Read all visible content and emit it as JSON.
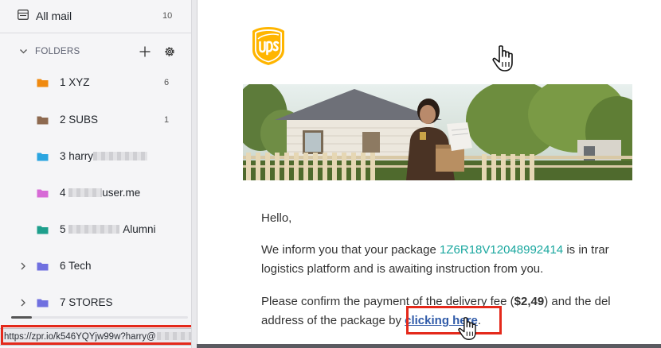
{
  "sidebar": {
    "all_mail": {
      "label": "All mail",
      "count": "10"
    },
    "folders_header": {
      "label": "FOLDERS"
    },
    "folders": [
      {
        "name": "1 XYZ",
        "suffix": "",
        "count": "6",
        "color": "#f08a10",
        "expandable": false
      },
      {
        "name": "2 SUBS",
        "suffix": "",
        "count": "1",
        "color": "#8e6a50",
        "expandable": false
      },
      {
        "name": "3 harry",
        "suffix": "",
        "count": "",
        "color": "#2ba5e0",
        "expandable": false
      },
      {
        "name": "4 ",
        "suffix": "user.me",
        "count": "",
        "color": "#d76ad6",
        "expandable": false
      },
      {
        "name": "5 ",
        "suffix": "Alumni",
        "count": "",
        "color": "#1e9f8c",
        "expandable": false
      },
      {
        "name": "6 Tech",
        "suffix": "",
        "count": "",
        "color": "#7070e0",
        "expandable": true
      },
      {
        "name": "7 STORES",
        "suffix": "",
        "count": "",
        "color": "#7070e0",
        "expandable": true
      }
    ]
  },
  "status_bar": {
    "url": "https://zpr.io/k546YQYjw99w?harry@"
  },
  "email": {
    "greeting": "Hello,",
    "p1_prefix": "We inform you that your package ",
    "tracking_number": "1Z6R18V12048992414",
    "p1_suffix": " is in trar",
    "p1_line2": "logistics platform and is awaiting instruction from you.",
    "p2_line1_prefix": "Please confirm the payment of the delivery fee (",
    "fee": "$2,49",
    "p2_line1_suffix": ") and the del",
    "p2_line2_prefix": "address of the package by ",
    "link_text": "clicking here",
    "p2_line2_suffix": "."
  },
  "colors": {
    "alert_box": "#e4291b",
    "link": "#2f5aa8",
    "tracking": "#1aa79f",
    "ups_brown": "#351c15",
    "ups_gold": "#ffb500"
  },
  "icons": [
    "mail-icon",
    "chevron-down-icon",
    "plus-icon",
    "gear-icon",
    "folder-icon",
    "chevron-right-icon",
    "ups-logo",
    "hand-pointer-icon"
  ]
}
